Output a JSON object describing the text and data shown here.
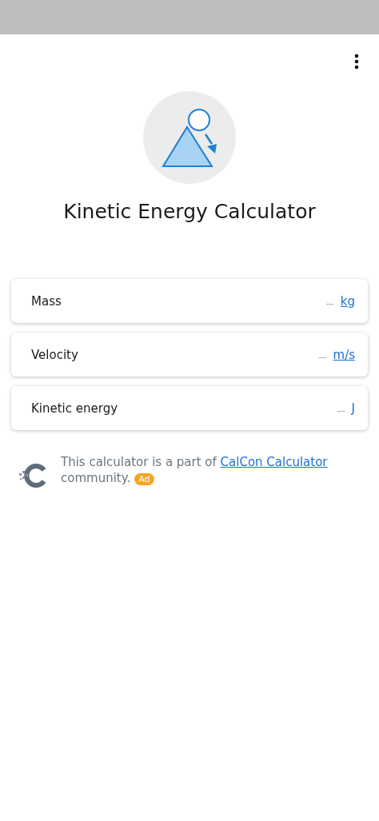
{
  "title": "Kinetic Energy Calculator",
  "fields": [
    {
      "label": "Mass",
      "placeholder": "---",
      "unit": "kg"
    },
    {
      "label": "Velocity",
      "placeholder": "---",
      "unit": "m/s"
    },
    {
      "label": "Kinetic energy",
      "placeholder": "---",
      "unit": "J"
    }
  ],
  "footer": {
    "text": "This calculator is a part of ",
    "link": "CalCon Calculator",
    "text_after": " community.",
    "badge": "Ad"
  }
}
